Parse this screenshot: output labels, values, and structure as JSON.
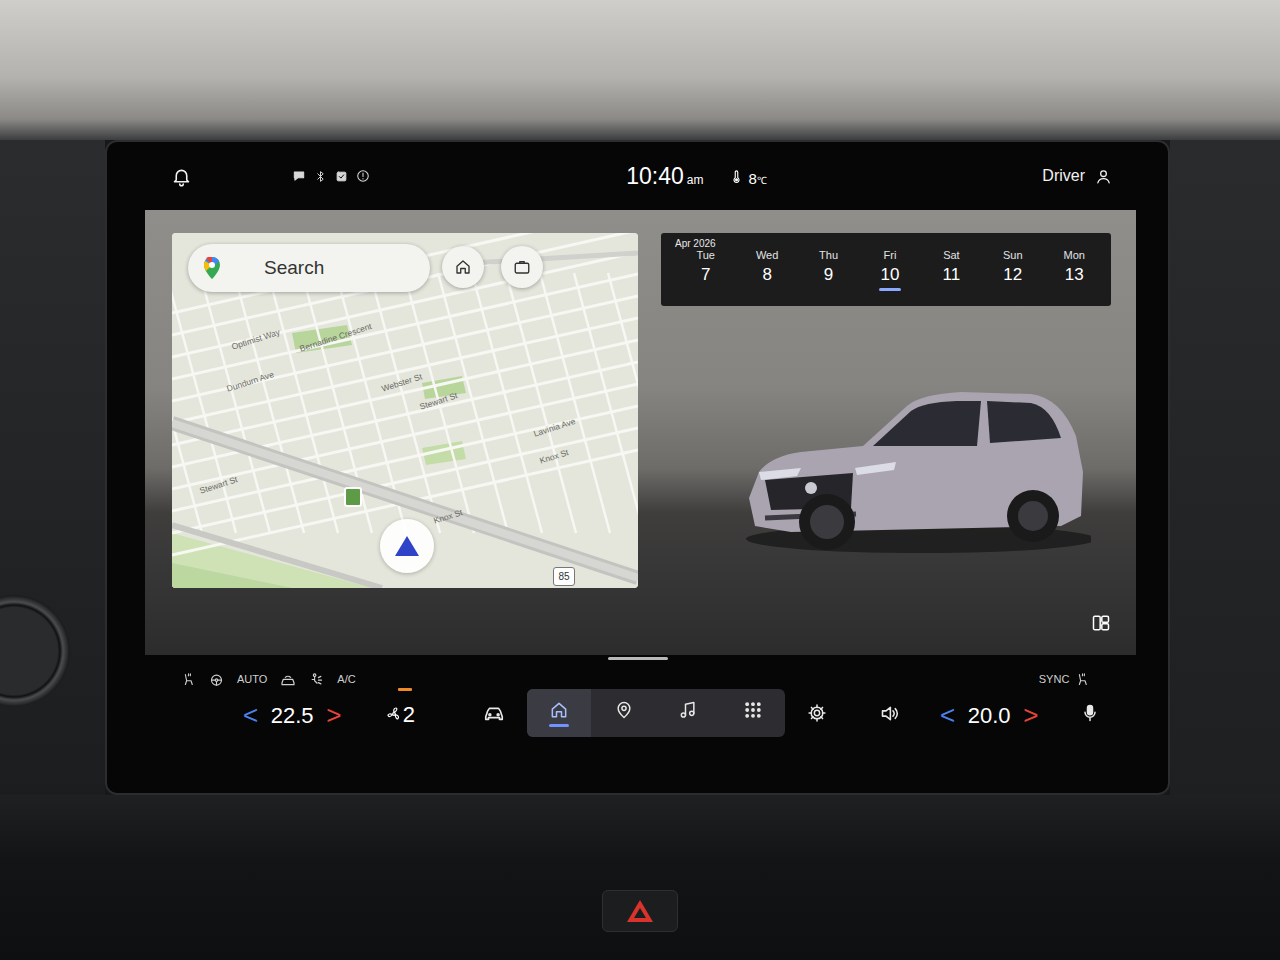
{
  "status_bar": {
    "time": "10:40",
    "ampm": "am",
    "temperature": "8",
    "temp_unit": "℃",
    "profile": "Driver"
  },
  "map": {
    "search": {
      "label": "Search"
    },
    "labels": [
      {
        "text": "Optimist Way"
      },
      {
        "text": "Bernadine Crescent"
      },
      {
        "text": "Dundurn Ave"
      },
      {
        "text": "Webster St"
      },
      {
        "text": "Stewart St"
      },
      {
        "text": "Lavinia Ave"
      },
      {
        "text": "Knox St"
      },
      {
        "text": "Stewart St"
      },
      {
        "text": "Knox St"
      }
    ],
    "route_shield": "85"
  },
  "calendar": {
    "month": "Apr 2026",
    "days": [
      {
        "name": "Tue",
        "date": "7",
        "selected": false
      },
      {
        "name": "Wed",
        "date": "8",
        "selected": false
      },
      {
        "name": "Thu",
        "date": "9",
        "selected": false
      },
      {
        "name": "Fri",
        "date": "10",
        "selected": true
      },
      {
        "name": "Sat",
        "date": "11",
        "selected": false
      },
      {
        "name": "Sun",
        "date": "12",
        "selected": false
      },
      {
        "name": "Mon",
        "date": "13",
        "selected": false
      }
    ]
  },
  "climate": {
    "driver": {
      "decrease": "<",
      "temperature": "22.5",
      "increase": ">"
    },
    "auto": "AUTO",
    "ac": "A/C",
    "fan_speed": "2",
    "passenger": {
      "decrease": "<",
      "temperature": "20.0",
      "increase": ">"
    },
    "sync": "SYNC"
  },
  "nav_tabs": [
    {
      "selected": true
    },
    {
      "selected": false
    },
    {
      "selected": false
    },
    {
      "selected": false
    }
  ]
}
